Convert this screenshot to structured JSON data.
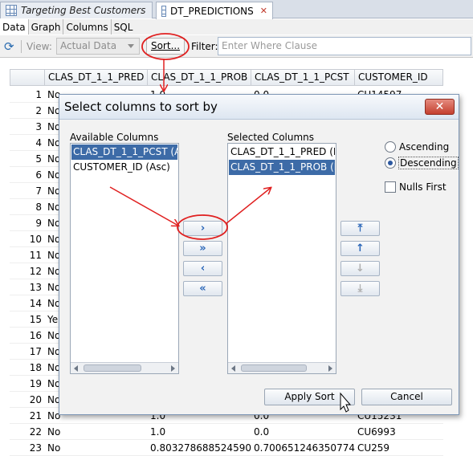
{
  "editor_tabs": [
    {
      "label": "Targeting Best Customers",
      "active": false
    },
    {
      "label": "DT_PREDICTIONS",
      "active": true
    }
  ],
  "subtabs": [
    "Data",
    "Graph",
    "Columns",
    "SQL"
  ],
  "toolbar": {
    "view_label": "View:",
    "view_value": "Actual Data",
    "sort_label": "Sort...",
    "filter_label": "Filter:",
    "filter_placeholder": "Enter Where Clause"
  },
  "grid": {
    "columns": [
      "CLAS_DT_1_1_PRED",
      "CLAS_DT_1_1_PROB",
      "CLAS_DT_1_1_PCST",
      "CUSTOMER_ID"
    ],
    "rows": [
      {
        "n": "1",
        "cells": [
          "No",
          "1.0",
          "0.0",
          "CU14597"
        ]
      },
      {
        "n": "2",
        "cells": [
          "No",
          "",
          "",
          ""
        ]
      },
      {
        "n": "3",
        "cells": [
          "No",
          "",
          "",
          ""
        ]
      },
      {
        "n": "4",
        "cells": [
          "No",
          "",
          "",
          ""
        ]
      },
      {
        "n": "5",
        "cells": [
          "No",
          "",
          "",
          ""
        ]
      },
      {
        "n": "6",
        "cells": [
          "No",
          "",
          "",
          ""
        ]
      },
      {
        "n": "7",
        "cells": [
          "No",
          "",
          "",
          ""
        ]
      },
      {
        "n": "8",
        "cells": [
          "No",
          "",
          "",
          ""
        ]
      },
      {
        "n": "9",
        "cells": [
          "No",
          "",
          "",
          ""
        ]
      },
      {
        "n": "10",
        "cells": [
          "No",
          "",
          "",
          ""
        ]
      },
      {
        "n": "11",
        "cells": [
          "No",
          "",
          "",
          ""
        ]
      },
      {
        "n": "12",
        "cells": [
          "No",
          "",
          "",
          ""
        ]
      },
      {
        "n": "13",
        "cells": [
          "No",
          "",
          "",
          ""
        ]
      },
      {
        "n": "14",
        "cells": [
          "No",
          "",
          "",
          ""
        ]
      },
      {
        "n": "15",
        "cells": [
          "Ye",
          "",
          "",
          ""
        ]
      },
      {
        "n": "16",
        "cells": [
          "No",
          "",
          "",
          ""
        ]
      },
      {
        "n": "17",
        "cells": [
          "No",
          "",
          "",
          ""
        ]
      },
      {
        "n": "18",
        "cells": [
          "No",
          "",
          "",
          ""
        ]
      },
      {
        "n": "19",
        "cells": [
          "No",
          "",
          "",
          ""
        ]
      },
      {
        "n": "20",
        "cells": [
          "No",
          "",
          "",
          ""
        ]
      },
      {
        "n": "21",
        "cells": [
          "No",
          "1.0",
          "0.0",
          "CU15231"
        ]
      },
      {
        "n": "22",
        "cells": [
          "No",
          "1.0",
          "0.0",
          "CU6993"
        ]
      },
      {
        "n": "23",
        "cells": [
          "No",
          "0.8032786885245902",
          "0.7006512463507748",
          "CU259"
        ]
      }
    ]
  },
  "dialog": {
    "title": "Select columns to sort by",
    "available_label": "Available Columns",
    "available_items": [
      {
        "label": "CLAS_DT_1_1_PCST (A",
        "selected": true
      },
      {
        "label": "CUSTOMER_ID (Asc)",
        "selected": false
      }
    ],
    "selected_label": "Selected Columns",
    "selected_items": [
      {
        "label": "CLAS_DT_1_1_PRED (D",
        "selected": false
      },
      {
        "label": "CLAS_DT_1_1_PROB (D",
        "selected": true
      }
    ],
    "ascending_label": "Ascending",
    "descending_label": "Descending",
    "order": "descending",
    "nulls_first_label": "Nulls First",
    "nulls_first": false,
    "apply_label": "Apply Sort",
    "cancel_label": "Cancel",
    "move_buttons": [
      {
        "glyph": "›",
        "name": "move-right-icon"
      },
      {
        "glyph": "»",
        "name": "move-all-right-icon"
      },
      {
        "glyph": "‹",
        "name": "move-left-icon"
      },
      {
        "glyph": "«",
        "name": "move-all-left-icon"
      }
    ],
    "order_buttons": [
      {
        "glyph": "⤒",
        "name": "move-top-icon"
      },
      {
        "glyph": "↑",
        "name": "move-up-icon"
      },
      {
        "glyph": "↓",
        "name": "move-down-icon"
      },
      {
        "glyph": "⤓",
        "name": "move-bottom-icon"
      }
    ]
  },
  "colors": {
    "selection": "#3d6ba7",
    "annotation": "#e02020",
    "tab_bg": "#d9dfe8"
  }
}
